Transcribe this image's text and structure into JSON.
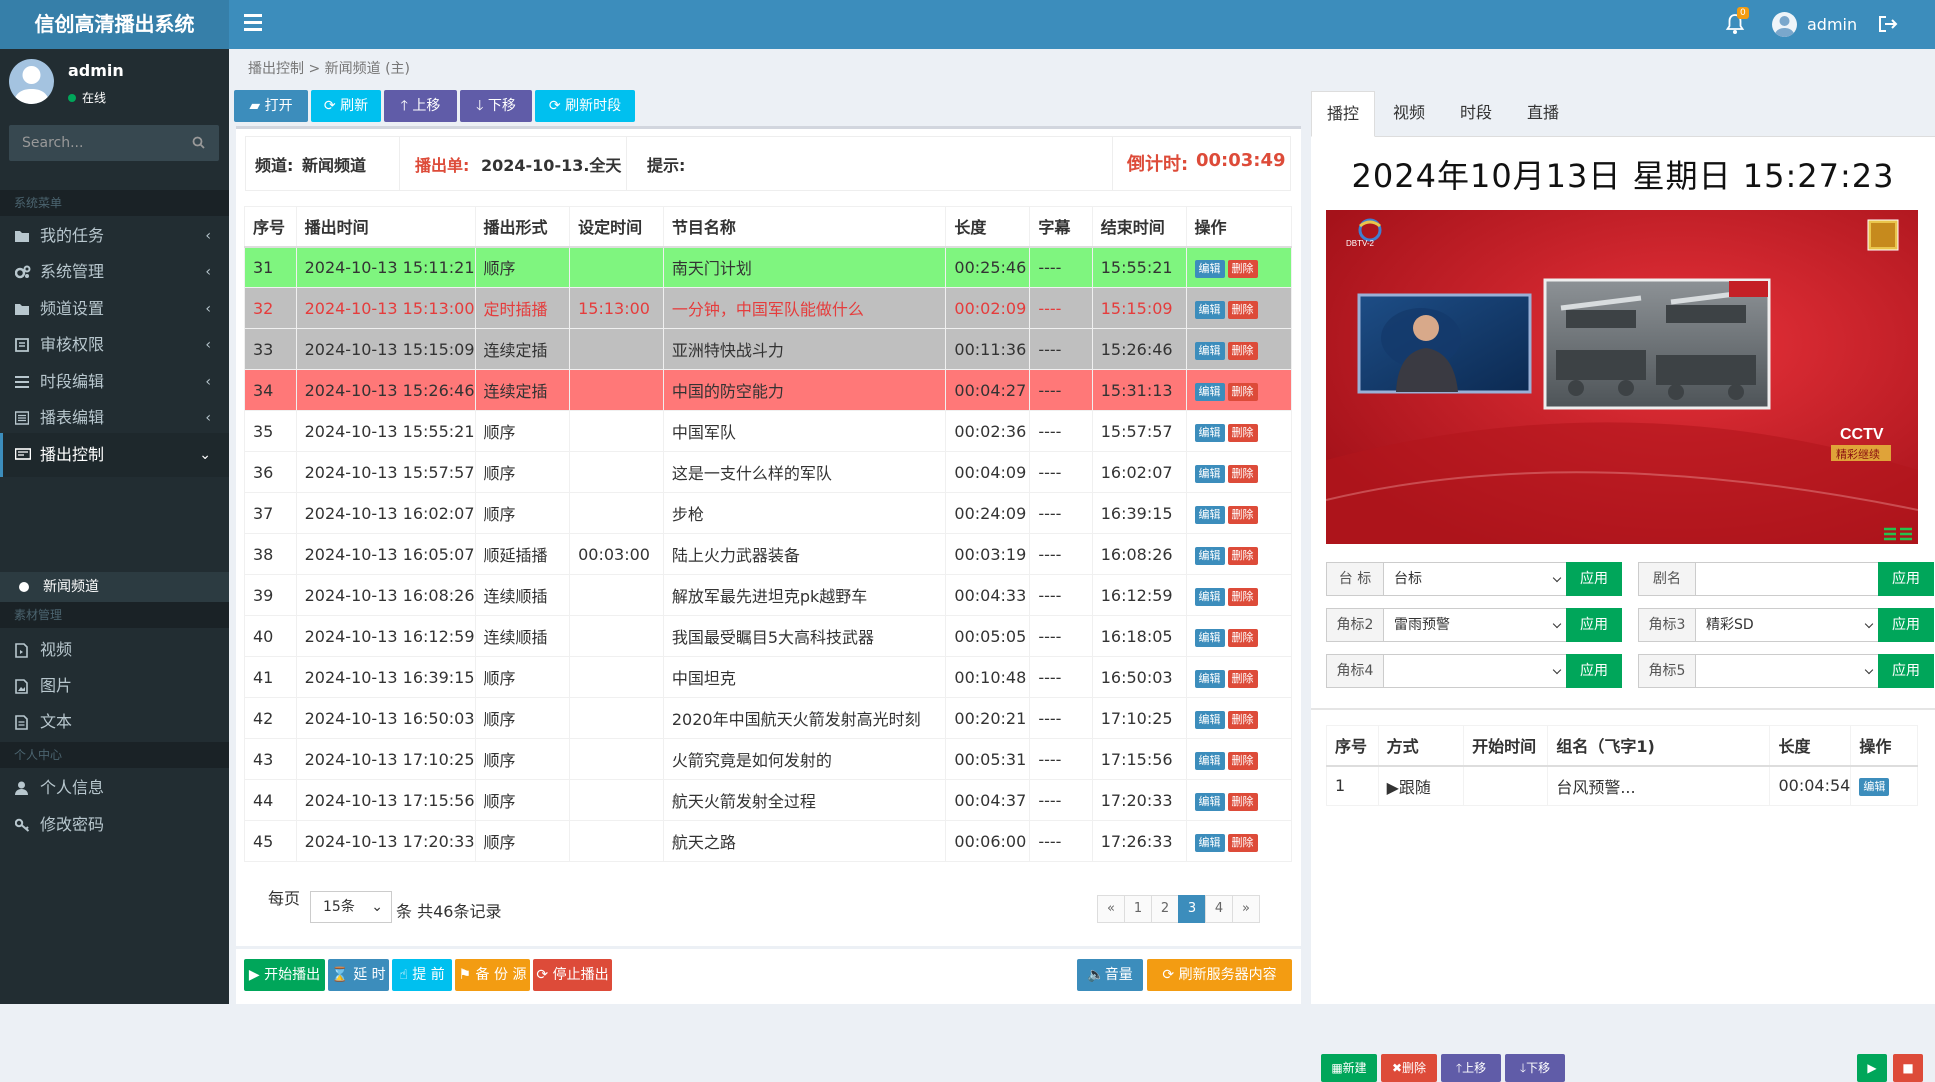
{
  "app": {
    "title": "信创高清播出系统",
    "user": "admin",
    "notif_count": "0"
  },
  "sidebar": {
    "user_name": "admin",
    "user_status": "在线",
    "search_placeholder": "Search...",
    "header1": "系统菜单",
    "header2": "素材管理",
    "header3": "个人中心",
    "items": [
      {
        "label": "我的任务",
        "icon": "folder-icon"
      },
      {
        "label": "系统管理",
        "icon": "cogs-icon"
      },
      {
        "label": "频道设置",
        "icon": "folder-icon"
      },
      {
        "label": "审核权限",
        "icon": "file-icon"
      },
      {
        "label": "时段编辑",
        "icon": "list-icon"
      },
      {
        "label": "播表编辑",
        "icon": "list-alt-icon"
      },
      {
        "label": "播出控制",
        "icon": "monitor-icon",
        "active": true
      },
      {
        "label": "新闻频道",
        "icon": "circle-icon",
        "sub": true
      },
      {
        "label": "视频",
        "icon": "file-video-icon"
      },
      {
        "label": "图片",
        "icon": "file-image-icon"
      },
      {
        "label": "文本",
        "icon": "file-text-icon"
      },
      {
        "label": "个人信息",
        "icon": "user-icon"
      },
      {
        "label": "修改密码",
        "icon": "key-icon"
      }
    ]
  },
  "breadcrumb": {
    "root": "播出控制",
    "sep": ">",
    "current": "新闻频道 (主)"
  },
  "toolbar": {
    "open": "打开",
    "refresh": "刷新",
    "up": "上移",
    "down": "下移",
    "refresh_slot": "刷新时段"
  },
  "info": {
    "channel_label": "频道:",
    "channel": "新闻频道",
    "sheet_label": "播出单:",
    "sheet": "2024-10-13.全天",
    "tip_label": "提示:",
    "countdown_label": "倒计时:",
    "countdown": "00:03:49"
  },
  "table": {
    "headers": [
      "序号",
      "播出时间",
      "播出形式",
      "设定时间",
      "节目名称",
      "长度",
      "字幕",
      "结束时间",
      "操作"
    ],
    "edit": "编辑",
    "del": "删除",
    "rows": [
      [
        "31",
        "2024-10-13 15:11:21",
        "顺序",
        "",
        "南天门计划",
        "00:25:46",
        "----",
        "15:55:21"
      ],
      [
        "32",
        "2024-10-13 15:13:00",
        "定时插播",
        "15:13:00",
        "一分钟，中国军队能做什么",
        "00:02:09",
        "----",
        "15:15:09"
      ],
      [
        "33",
        "2024-10-13 15:15:09",
        "连续定插",
        "",
        "亚洲特快战斗力",
        "00:11:36",
        "----",
        "15:26:46"
      ],
      [
        "34",
        "2024-10-13 15:26:46",
        "连续定插",
        "",
        "中国的防空能力",
        "00:04:27",
        "----",
        "15:31:13"
      ],
      [
        "35",
        "2024-10-13 15:55:21",
        "顺序",
        "",
        "中国军队",
        "00:02:36",
        "----",
        "15:57:57"
      ],
      [
        "36",
        "2024-10-13 15:57:57",
        "顺序",
        "",
        "这是一支什么样的军队",
        "00:04:09",
        "----",
        "16:02:07"
      ],
      [
        "37",
        "2024-10-13 16:02:07",
        "顺序",
        "",
        "步枪",
        "00:24:09",
        "----",
        "16:39:15"
      ],
      [
        "38",
        "2024-10-13 16:05:07",
        "顺延插播",
        "00:03:00",
        "陆上火力武器装备",
        "00:03:19",
        "----",
        "16:08:26"
      ],
      [
        "39",
        "2024-10-13 16:08:26",
        "连续顺插",
        "",
        "解放军最先进坦克pk越野车",
        "00:04:33",
        "----",
        "16:12:59"
      ],
      [
        "40",
        "2024-10-13 16:12:59",
        "连续顺插",
        "",
        "我国最受瞩目5大高科技武器",
        "00:05:05",
        "----",
        "16:18:05"
      ],
      [
        "41",
        "2024-10-13 16:39:15",
        "顺序",
        "",
        "中国坦克",
        "00:10:48",
        "----",
        "16:50:03"
      ],
      [
        "42",
        "2024-10-13 16:50:03",
        "顺序",
        "",
        "2020年中国航天火箭发射高光时刻",
        "00:20:21",
        "----",
        "17:10:25"
      ],
      [
        "43",
        "2024-10-13 17:10:25",
        "顺序",
        "",
        "火箭究竟是如何发射的",
        "00:05:31",
        "----",
        "17:15:56"
      ],
      [
        "44",
        "2024-10-13 17:15:56",
        "顺序",
        "",
        "航天火箭发射全过程",
        "00:04:37",
        "----",
        "17:20:33"
      ],
      [
        "45",
        "2024-10-13 17:20:33",
        "顺序",
        "",
        "航天之路",
        "00:06:00",
        "----",
        "17:26:33"
      ]
    ],
    "row_styles": [
      "r-green",
      "r-grayred",
      "r-gray",
      "r-red",
      "",
      "",
      "",
      "",
      "",
      "",
      "",
      "",
      "",
      "",
      ""
    ]
  },
  "pager": {
    "per_page_label": "每页",
    "per_page": "15条",
    "total": "条 共46条记录",
    "pages": [
      "«",
      "1",
      "2",
      "3",
      "4",
      "»"
    ],
    "current": "3"
  },
  "bottom_left": {
    "start": "开始播出",
    "delay": "延 时",
    "advance": "提 前",
    "backup": "备 份 源",
    "stop": "停止播出",
    "volume": "音量",
    "refresh_server": "刷新服务器内容"
  },
  "right": {
    "tabs": [
      "播控",
      "视频",
      "时段",
      "直播"
    ],
    "clock": "2024年10月13日   星期日   15:27:23",
    "video": {
      "channel_logo": "DBTV-2",
      "corner_badge": "CCTV",
      "lower_text": "精彩继续"
    },
    "logos": [
      {
        "label": "台 标",
        "value": "台标"
      },
      {
        "label": "剧名",
        "value": ""
      },
      {
        "label": "角标2",
        "value": "雷雨预警"
      },
      {
        "label": "角标3",
        "value": "精彩SD"
      },
      {
        "label": "角标4",
        "value": ""
      },
      {
        "label": "角标5",
        "value": ""
      }
    ],
    "apply": "应用",
    "sub_headers": [
      "序号",
      "方式",
      "开始时间",
      "组名（飞字1)",
      "长度",
      "操作"
    ],
    "sub_rows": [
      [
        "1",
        "▶跟随",
        "",
        "台风预警...",
        "00:04:54"
      ]
    ],
    "sub_edit": "编辑",
    "buttons": {
      "new": "新建",
      "del": "删除",
      "up": "上移",
      "down": "下移"
    }
  }
}
